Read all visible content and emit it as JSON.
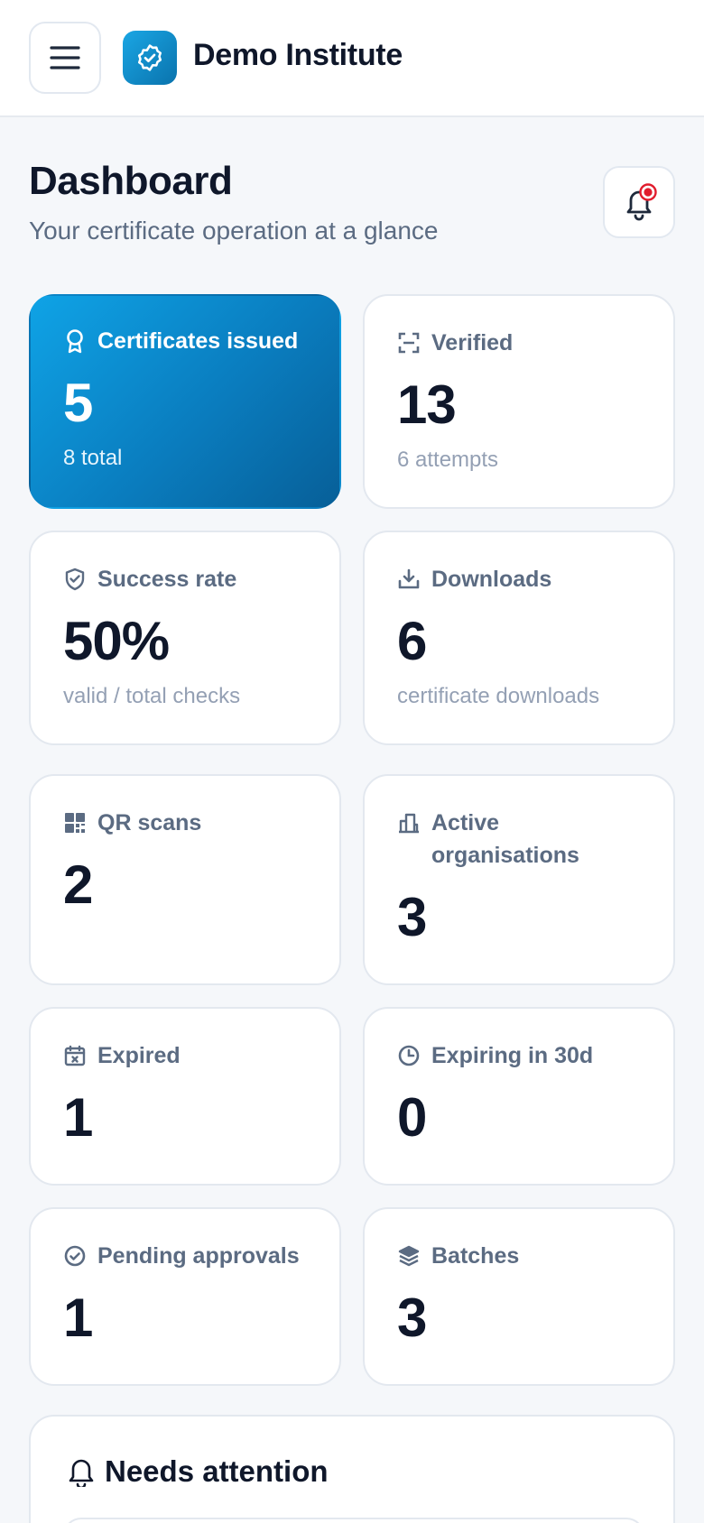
{
  "header": {
    "brand": "Demo Institute",
    "menu_icon": "hamburger-icon",
    "logo_icon": "verified-badge-icon"
  },
  "page": {
    "title": "Dashboard",
    "subtitle": "Your certificate operation at a glance",
    "notification_icon": "bell-icon"
  },
  "colors": {
    "accent": "#0a7dbf",
    "notification_dot": "#e11d2e"
  },
  "stats": [
    {
      "label": "Certificates issued",
      "value": "5",
      "note": "8 total",
      "icon": "award-icon"
    },
    {
      "label": "Verified",
      "value": "13",
      "note": "6 attempts",
      "icon": "scan-icon"
    },
    {
      "label": "Success rate",
      "value": "50%",
      "note": "valid / total checks",
      "icon": "shield-check-icon"
    },
    {
      "label": "Downloads",
      "value": "6",
      "note": "certificate downloads",
      "icon": "download-icon"
    },
    {
      "label": "QR scans",
      "value": "2",
      "note": "",
      "icon": "qr-icon"
    },
    {
      "label": "Active organisations",
      "value": "3",
      "note": "",
      "icon": "building-icon"
    },
    {
      "label": "Expired",
      "value": "1",
      "note": "",
      "icon": "calendar-x-icon"
    },
    {
      "label": "Expiring in 30d",
      "value": "0",
      "note": "",
      "icon": "clock-icon"
    },
    {
      "label": "Pending approvals",
      "value": "1",
      "note": "",
      "icon": "check-circle-icon"
    },
    {
      "label": "Batches",
      "value": "3",
      "note": "",
      "icon": "layers-icon"
    }
  ],
  "attention": {
    "title": "Needs attention",
    "icon": "bell-icon"
  }
}
